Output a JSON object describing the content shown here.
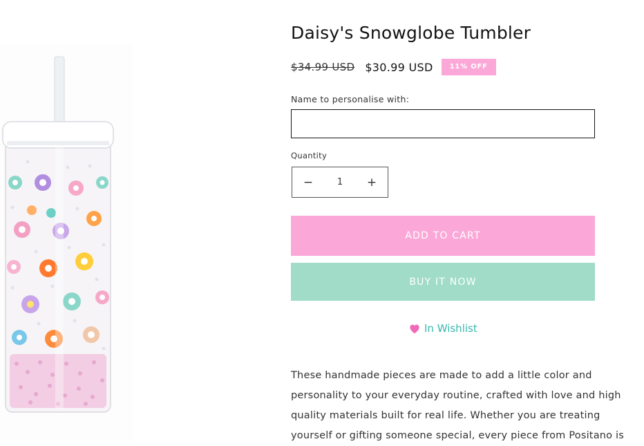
{
  "product": {
    "title": "Daisy's Snowglobe Tumbler",
    "price_compare": "$34.99 USD",
    "price_sale": "$30.99 USD",
    "badge": "11% OFF",
    "image_alt": "Daisy's Snowglobe Tumbler"
  },
  "personalise": {
    "label": "Name to personalise with:",
    "value": ""
  },
  "quantity": {
    "label": "Quantity",
    "value": "1",
    "minus_symbol": "−",
    "plus_symbol": "+"
  },
  "buttons": {
    "add_to_cart": "ADD TO CART",
    "buy_now": "BUY IT NOW",
    "wishlist": "In Wishlist"
  },
  "icons": {
    "wishlist": "heart-icon"
  },
  "description_lines": [
    "These handmade pieces are made to add a little color and",
    "personality to your everyday routine, crafted with love and high",
    "quality materials built for real life. Whether you are treating",
    "yourself or gifting someone special, every piece from Positano is"
  ],
  "colors": {
    "accent_pink": "#fba8d8",
    "accent_mint": "#a0dcc8",
    "wishlist_teal": "#38b7ae",
    "heart_pink": "#f06ab8"
  }
}
